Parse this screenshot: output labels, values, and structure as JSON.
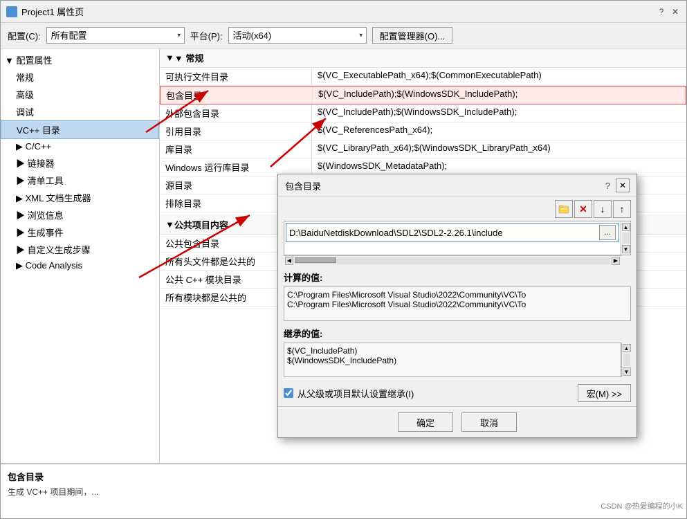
{
  "mainDialog": {
    "title": "Project1 属性页",
    "questionMark": "?",
    "closeBtn": "✕"
  },
  "configBar": {
    "configLabel": "配置(C):",
    "configValue": "所有配置",
    "platformLabel": "平台(P):",
    "platformValue": "活动(x64)",
    "managerBtn": "配置管理器(O)..."
  },
  "sidebar": {
    "rootLabel": "▼ 配置属性",
    "items": [
      {
        "label": "常规",
        "indent": 1
      },
      {
        "label": "高级",
        "indent": 1
      },
      {
        "label": "调试",
        "indent": 1
      },
      {
        "label": "VC++ 目录",
        "indent": 1,
        "selected": true
      },
      {
        "label": "▶ C/C++",
        "indent": 1
      },
      {
        "label": "▶ 链接器",
        "indent": 1
      },
      {
        "label": "▶ 清单工具",
        "indent": 1
      },
      {
        "label": "▶ XML 文档生成器",
        "indent": 1
      },
      {
        "label": "▶ 浏览信息",
        "indent": 1
      },
      {
        "label": "▶ 生成事件",
        "indent": 1
      },
      {
        "label": "▶ 自定义生成步骤",
        "indent": 1
      },
      {
        "label": "▶ Code Analysis",
        "indent": 1
      }
    ]
  },
  "rightPanel": {
    "sectionLabel": "▼ 常规",
    "rows": [
      {
        "name": "可执行文件目录",
        "value": "$(VC_ExecutablePath_x64);$(CommonExecutablePath)",
        "highlighted": false
      },
      {
        "name": "包含目录",
        "value": "$(VC_IncludePath);$(WindowsSDK_IncludePath);",
        "highlighted": true
      },
      {
        "name": "外部包含目录",
        "value": "$(VC_IncludePath);$(WindowsSDK_IncludePath);",
        "highlighted": false
      },
      {
        "name": "引用目录",
        "value": "$(VC_ReferencesPath_x64);",
        "highlighted": false
      },
      {
        "name": "库目录",
        "value": "$(VC_LibraryPath_x64);$(WindowsSDK_LibraryPath_x64)",
        "highlighted": false
      },
      {
        "name": "Windows 运行库目录",
        "value": "$(WindowsSDK_MetadataPath);",
        "highlighted": false
      },
      {
        "name": "源目录",
        "value": "",
        "highlighted": false
      },
      {
        "name": "排除目录",
        "value": "",
        "highlighted": false
      }
    ],
    "sectionLabel2": "▼ 公共项目内容",
    "rows2": [
      {
        "name": "公共包含目录",
        "value": "",
        "highlighted": false
      },
      {
        "name": "所有头文件都是公共的",
        "value": "",
        "highlighted": false
      },
      {
        "name": "公共 C++ 模块目录",
        "value": "",
        "highlighted": false
      },
      {
        "name": "所有模块都是公共的",
        "value": "",
        "highlighted": false
      }
    ]
  },
  "bottomPanel": {
    "title": "包含目录",
    "desc": "生成 VC++ 项目期间，..."
  },
  "overlayDialog": {
    "title": "包含目录",
    "questionMark": "?",
    "closeBtn": "✕",
    "toolbarBtns": [
      "📁",
      "✕",
      "↓",
      "↑"
    ],
    "listItem": "D:\\BaiduNetdiskDownload\\SDL2\\SDL2-2.26.1\\include",
    "browseBtn": "...",
    "calcTitle": "计算的值:",
    "calcLines": [
      "C:\\Program Files\\Microsoft Visual Studio\\2022\\Community\\VC\\To",
      "C:\\Program Files\\Microsoft Visual Studio\\2022\\Community\\VC\\To"
    ],
    "inheritTitle": "继承的值:",
    "inheritLines": [
      "$(VC_IncludePath)",
      "$(WindowsSDK_IncludePath)"
    ],
    "checkboxLabel": "从父级或项目默认设置继承(I)",
    "macroBtn": "宏(M) >>",
    "okBtn": "确定",
    "cancelBtn": "取消"
  },
  "watermark": "CSDN @热爱编程的小K"
}
